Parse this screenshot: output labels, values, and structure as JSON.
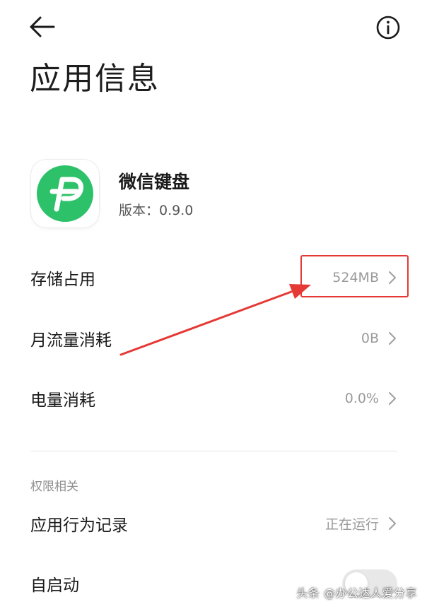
{
  "header": {
    "title": "应用信息"
  },
  "app": {
    "name": "微信键盘",
    "version": "版本：0.9.0",
    "icon_name": "wetype-logo-icon",
    "icon_color": "#2dc26a"
  },
  "usage_rows": [
    {
      "label": "存储占用",
      "value": "524MB"
    },
    {
      "label": "月流量消耗",
      "value": "0B"
    },
    {
      "label": "电量消耗",
      "value": "0.0%"
    }
  ],
  "permissions_section": {
    "header": "权限相关",
    "rows": [
      {
        "label": "应用行为记录",
        "value": "正在运行"
      },
      {
        "label": "自启动",
        "toggle_on": false
      }
    ]
  },
  "annotation": {
    "highlight_color": "#e53935"
  },
  "watermark": "头条 @办公达人爱分享"
}
